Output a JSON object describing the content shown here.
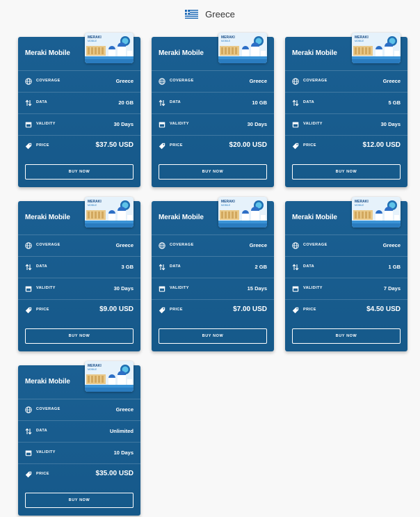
{
  "header": {
    "country": "Greece",
    "flag_icon": "greece-flag-icon"
  },
  "labels": {
    "coverage": "COVERAGE",
    "data": "DATA",
    "validity": "VALIDITY",
    "price": "PRICE",
    "buy": "BUY NOW"
  },
  "thumbnail": {
    "brand_line1": "MERAKI",
    "brand_line2": "MOBILE"
  },
  "colors": {
    "card_bg": "#1a5f92",
    "page_bg": "#f8f8f8",
    "text": "#ffffff"
  },
  "plans": [
    {
      "provider": "Meraki Mobile",
      "coverage": "Greece",
      "data": "20 GB",
      "validity": "30 Days",
      "price": "$37.50 USD"
    },
    {
      "provider": "Meraki Mobile",
      "coverage": "Greece",
      "data": "10 GB",
      "validity": "30 Days",
      "price": "$20.00 USD"
    },
    {
      "provider": "Meraki Mobile",
      "coverage": "Greece",
      "data": "5 GB",
      "validity": "30 Days",
      "price": "$12.00 USD"
    },
    {
      "provider": "Meraki Mobile",
      "coverage": "Greece",
      "data": "3 GB",
      "validity": "30 Days",
      "price": "$9.00 USD"
    },
    {
      "provider": "Meraki Mobile",
      "coverage": "Greece",
      "data": "2 GB",
      "validity": "15 Days",
      "price": "$7.00 USD"
    },
    {
      "provider": "Meraki Mobile",
      "coverage": "Greece",
      "data": "1 GB",
      "validity": "7 Days",
      "price": "$4.50 USD"
    },
    {
      "provider": "Meraki Mobile",
      "coverage": "Greece",
      "data": "Unlimited",
      "validity": "10 Days",
      "price": "$35.00 USD"
    }
  ]
}
